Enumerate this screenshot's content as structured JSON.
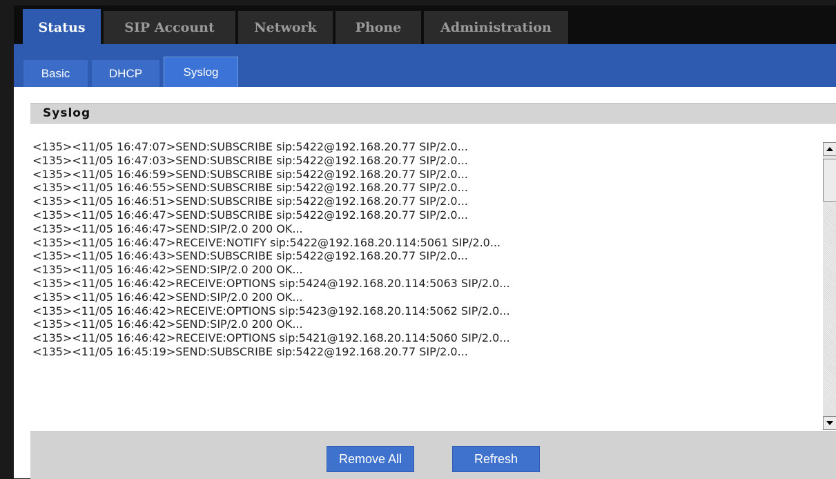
{
  "top_tabs": [
    {
      "label": "Status",
      "active": true
    },
    {
      "label": "SIP Account",
      "active": false
    },
    {
      "label": "Network",
      "active": false
    },
    {
      "label": "Phone",
      "active": false
    },
    {
      "label": "Administration",
      "active": false
    }
  ],
  "sub_tabs": [
    {
      "label": "Basic",
      "active": false
    },
    {
      "label": "DHCP",
      "active": false
    },
    {
      "label": "Syslog",
      "active": true
    }
  ],
  "section": {
    "title": "Syslog"
  },
  "log_lines": [
    "<135><11/05 16:47:07>SEND:SUBSCRIBE sip:5422@192.168.20.77 SIP/2.0...",
    "<135><11/05 16:47:03>SEND:SUBSCRIBE sip:5422@192.168.20.77 SIP/2.0...",
    "<135><11/05 16:46:59>SEND:SUBSCRIBE sip:5422@192.168.20.77 SIP/2.0...",
    "<135><11/05 16:46:55>SEND:SUBSCRIBE sip:5422@192.168.20.77 SIP/2.0...",
    "<135><11/05 16:46:51>SEND:SUBSCRIBE sip:5422@192.168.20.77 SIP/2.0...",
    "<135><11/05 16:46:47>SEND:SUBSCRIBE sip:5422@192.168.20.77 SIP/2.0...",
    "<135><11/05 16:46:47>SEND:SIP/2.0 200 OK...",
    "<135><11/05 16:46:47>RECEIVE:NOTIFY sip:5422@192.168.20.114:5061 SIP/2.0...",
    "<135><11/05 16:46:43>SEND:SUBSCRIBE sip:5422@192.168.20.77 SIP/2.0...",
    "<135><11/05 16:46:42>SEND:SIP/2.0 200 OK...",
    "<135><11/05 16:46:42>RECEIVE:OPTIONS sip:5424@192.168.20.114:5063 SIP/2.0...",
    "<135><11/05 16:46:42>SEND:SIP/2.0 200 OK...",
    "<135><11/05 16:46:42>RECEIVE:OPTIONS sip:5423@192.168.20.114:5062 SIP/2.0...",
    "<135><11/05 16:46:42>SEND:SIP/2.0 200 OK...",
    "<135><11/05 16:46:42>RECEIVE:OPTIONS sip:5421@192.168.20.114:5060 SIP/2.0...",
    "<135><11/05 16:45:19>SEND:SUBSCRIBE sip:5422@192.168.20.77 SIP/2.0..."
  ],
  "buttons": {
    "remove_all": "Remove All",
    "refresh": "Refresh"
  },
  "colors": {
    "accent": "#2e5baf",
    "button": "#3e72cc",
    "header_bg": "#d4d4d4"
  }
}
